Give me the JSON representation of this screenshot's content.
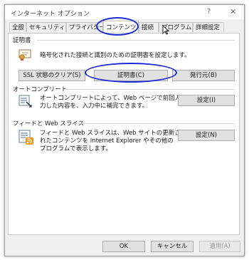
{
  "window": {
    "title": "インターネット オプション",
    "help_glyph": "?",
    "close_glyph": "✕"
  },
  "tabs": [
    {
      "label": "全般"
    },
    {
      "label": "セキュリティ"
    },
    {
      "label": "プライバシー"
    },
    {
      "label": "コンテンツ",
      "active": true
    },
    {
      "label": "接続"
    },
    {
      "label": "プログラム"
    },
    {
      "label": "詳細設定"
    }
  ],
  "certificates": {
    "heading": "証明書",
    "description": "暗号化された接続と識別のための証明書を設定します。",
    "buttons": {
      "clear_ssl": "SSL 状態のクリア(S)",
      "certificates": "証明書(C)",
      "publishers": "発行元(B)"
    }
  },
  "autocomplete": {
    "heading": "オートコンプリート",
    "description": [
      "オートコンプリートによって、Web ページで前回入",
      "力した内容を、入力中に補完できます。"
    ],
    "settings_button": "設定(I)"
  },
  "feeds": {
    "heading": "フィードと Web スライス",
    "description": [
      "フィードと Web スライスは、Web サイトの更新さ",
      "れたコンテンツを Internet Explorer やその他の",
      "プログラムで表示します。"
    ],
    "settings_button": "設定(N)"
  },
  "footer": {
    "ok": "OK",
    "cancel": "キャンセル",
    "apply": "適用(A)"
  },
  "colors": {
    "annotation": "#1b2bd6",
    "window_bg": "#f0f0f0",
    "button_bg": "#e1e1e1"
  }
}
